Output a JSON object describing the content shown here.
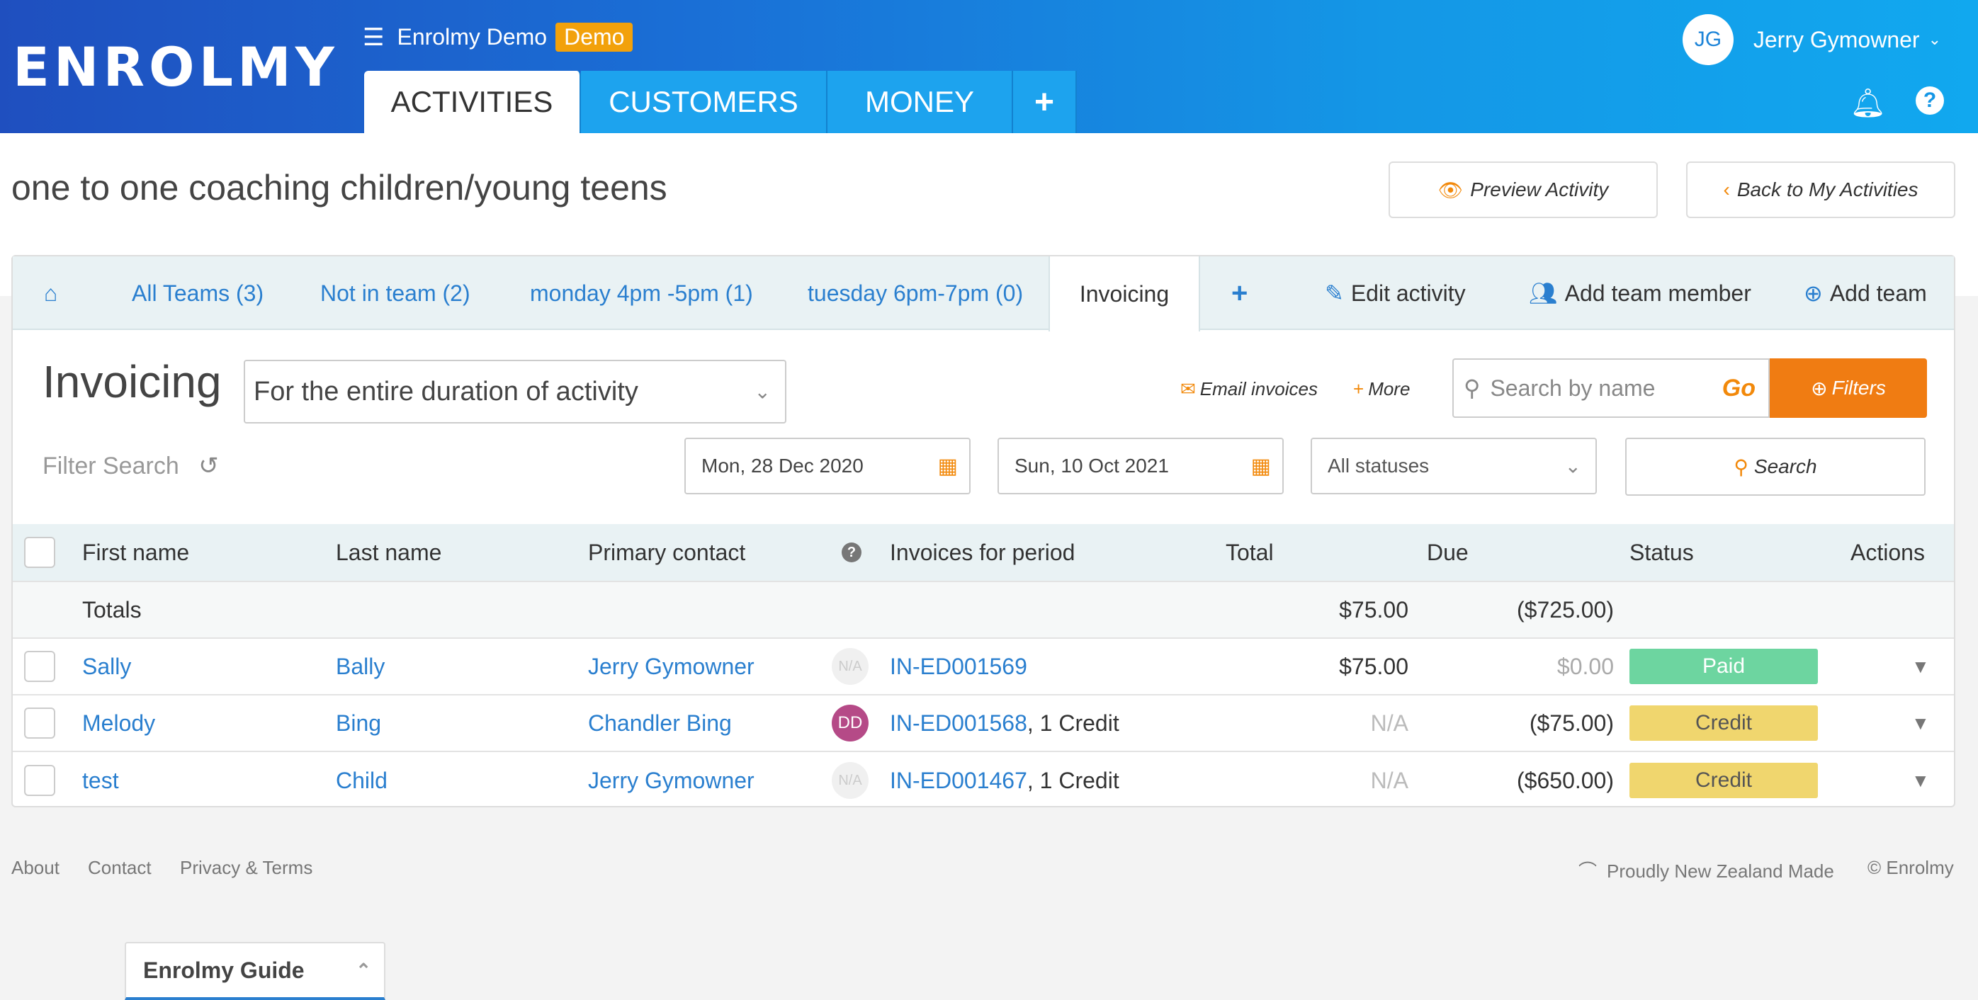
{
  "header": {
    "logo": "ENROLMY",
    "org_name": "Enrolmy Demo",
    "demo_badge": "Demo",
    "nav_tabs": [
      {
        "label": "ACTIVITIES"
      },
      {
        "label": "CUSTOMERS"
      },
      {
        "label": "MONEY"
      },
      {
        "label": "+"
      }
    ],
    "user_initials": "JG",
    "user_name": "Jerry Gymowner"
  },
  "page": {
    "title": "one to one coaching children/young teens",
    "preview_btn": "Preview Activity",
    "back_btn": "Back to My Activities"
  },
  "tabs": {
    "all_teams": "All Teams (3)",
    "not_in_team": "Not in team (2)",
    "monday": "monday 4pm -5pm (1)",
    "tuesday": "tuesday 6pm-7pm (0)",
    "invoicing": "Invoicing",
    "plus": "+",
    "edit_activity": "Edit activity",
    "add_member": "Add team member",
    "add_team": "Add team"
  },
  "invoicing": {
    "title": "Invoicing",
    "period": "For the entire duration of activity",
    "email_invoices": "Email invoices",
    "more": "More",
    "search_placeholder": "Search by name",
    "go": "Go",
    "filters": "Filters",
    "filter_search": "Filter Search",
    "date_from": "Mon, 28 Dec 2020",
    "date_to": "Sun, 10 Oct 2021",
    "status_select": "All statuses",
    "search_btn": "Search"
  },
  "table": {
    "headers": {
      "first_name": "First name",
      "last_name": "Last name",
      "primary_contact": "Primary contact",
      "invoices": "Invoices for period",
      "total": "Total",
      "due": "Due",
      "status": "Status",
      "actions": "Actions"
    },
    "totals": {
      "label": "Totals",
      "total": "$75.00",
      "due": "($725.00)"
    },
    "rows": [
      {
        "first": "Sally",
        "last": "Bally",
        "contact": "Jerry Gymowner",
        "contact_avatar": "N/A",
        "invoice": "IN-ED001569",
        "invoice_extra": "",
        "total": "$75.00",
        "due": "$0.00",
        "status": "Paid"
      },
      {
        "first": "Melody",
        "last": "Bing",
        "contact": "Chandler Bing",
        "contact_avatar": "DD",
        "invoice": "IN-ED001568",
        "invoice_extra": ", 1 Credit",
        "total": "N/A",
        "due": "($75.00)",
        "status": "Credit"
      },
      {
        "first": "test",
        "last": "Child",
        "contact": "Jerry Gymowner",
        "contact_avatar": "N/A",
        "invoice": "IN-ED001467",
        "invoice_extra": ", 1 Credit",
        "total": "N/A",
        "due": "($650.00)",
        "status": "Credit"
      }
    ]
  },
  "footer": {
    "about": "About",
    "contact": "Contact",
    "privacy": "Privacy & Terms",
    "nz_made": "Proudly New Zealand Made",
    "copyright": "© Enrolmy"
  },
  "guide": {
    "label": "Enrolmy Guide"
  },
  "colors": {
    "brand_blue": "#1a6fd6",
    "accent_orange": "#f07c12",
    "paid": "#6dd5a0",
    "credit": "#f0d66e"
  }
}
